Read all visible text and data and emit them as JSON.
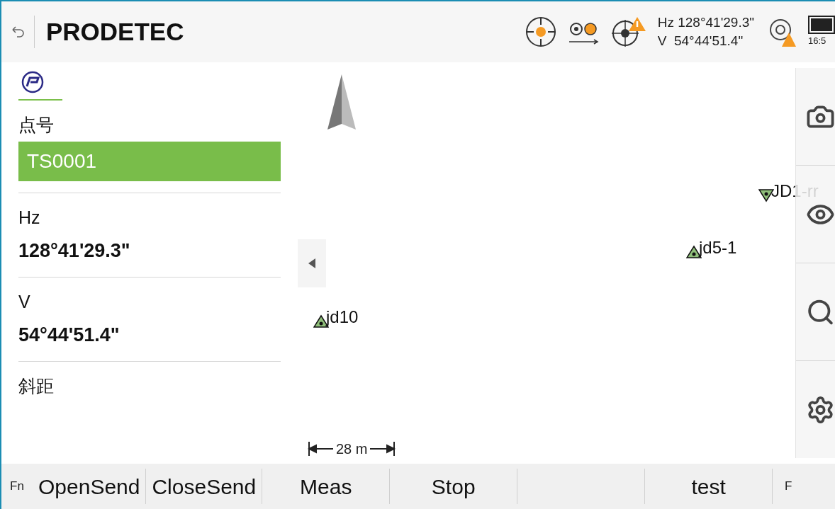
{
  "header": {
    "title": "PRODETEC",
    "hz": "Hz 128°41'29.3\"",
    "v": "V  54°44'51.4\"",
    "time": "16:5"
  },
  "panel": {
    "point_label": "点号",
    "point_value": "TS0001",
    "fields": [
      {
        "label": "Hz",
        "value": "128°41'29.3\""
      },
      {
        "label": "V",
        "value": "54°44'51.4\""
      },
      {
        "label": "斜距"
      }
    ]
  },
  "map": {
    "points": [
      {
        "label": "jd10",
        "kind": "up"
      },
      {
        "label": "jd5-1",
        "kind": "up"
      },
      {
        "label": "JD1-rr",
        "kind": "down"
      }
    ],
    "scale": "28 m"
  },
  "softkeys": [
    {
      "label": "Fn",
      "kind": "small"
    },
    {
      "label": "OpenSend",
      "kind": "key"
    },
    {
      "label": "CloseSend",
      "kind": "key"
    },
    {
      "label": "Meas",
      "kind": "key"
    },
    {
      "label": "Stop",
      "kind": "key"
    },
    {
      "kind": "blank"
    },
    {
      "label": "test",
      "kind": "key"
    },
    {
      "label": "F",
      "kind": "small"
    }
  ]
}
